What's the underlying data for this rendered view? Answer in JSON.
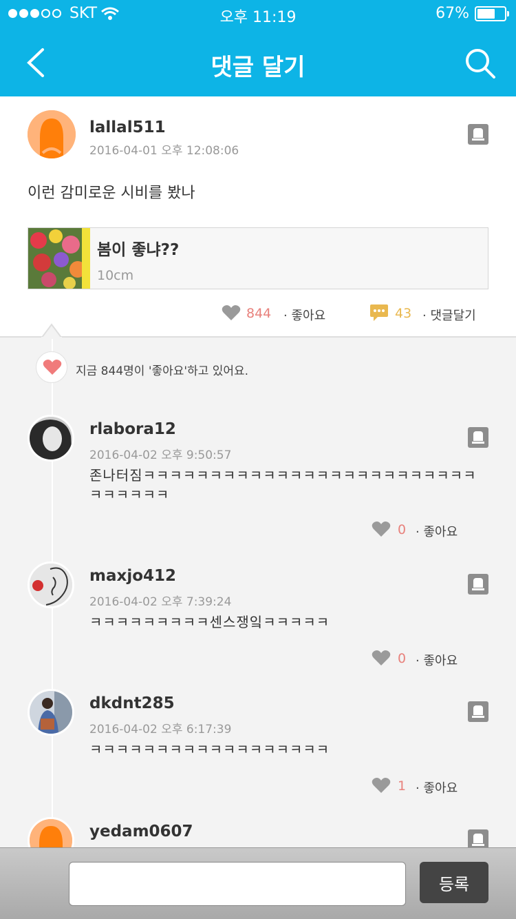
{
  "status_bar": {
    "carrier": "SKT",
    "time": "오후 11:19",
    "battery": "67%",
    "battery_level": 0.67
  },
  "header": {
    "title": "댓글 달기"
  },
  "post": {
    "username": "lallal511",
    "date": "2016-04-01 오후 12:08:06",
    "content": "이런 감미로운 시비를 봤나",
    "link": {
      "title": "봄이 좋냐??",
      "subtitle": "10cm"
    },
    "like_count": "844",
    "like_label": "· 좋아요",
    "comment_count": "43",
    "comment_label": "· 댓글달기"
  },
  "liked_banner": "지금 844명이 '좋아요'하고 있어요.",
  "comments": [
    {
      "username": "rlabora12",
      "date": "2016-04-02 오후 9:50:57",
      "text": "존나터짐ㅋㅋㅋㅋㅋㅋㅋㅋㅋㅋㅋㅋㅋㅋㅋㅋㅋㅋㅋㅋㅋㅋㅋㅋㅋㅋㅋㅋㅋㅋㅋ",
      "likes": "0",
      "like_label": "· 좋아요"
    },
    {
      "username": "maxjo412",
      "date": "2016-04-02 오후 7:39:24",
      "text": "ㅋㅋㅋㅋㅋㅋㅋㅋㅋ센스쟁잌ㅋㅋㅋㅋㅋ",
      "likes": "0",
      "like_label": "· 좋아요"
    },
    {
      "username": "dkdnt285",
      "date": "2016-04-02 오후 6:17:39",
      "text": "ㅋㅋㅋㅋㅋㅋㅋㅋㅋㅋㅋㅋㅋㅋㅋㅋㅋㅋ",
      "likes": "1",
      "like_label": "· 좋아요"
    },
    {
      "username": "yedam0607"
    }
  ],
  "input": {
    "value": "",
    "submit_label": "등록"
  },
  "colors": {
    "header": "#0db4e6",
    "like": "#e8817c",
    "comment": "#e9b84f"
  },
  "icons": {
    "back": "chevron-left-icon",
    "search": "search-icon",
    "report": "report-icon",
    "heart": "heart-icon",
    "comment": "speech-bubble-icon"
  }
}
